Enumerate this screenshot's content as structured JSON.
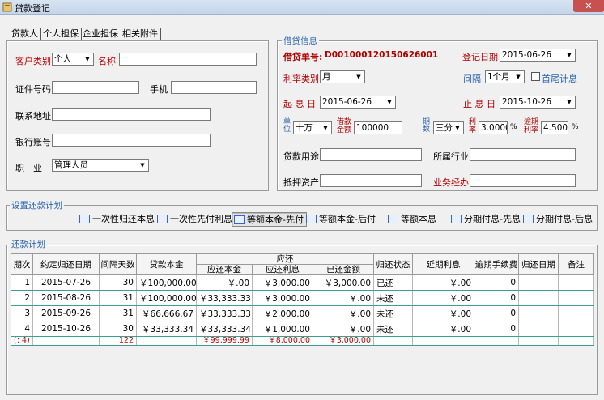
{
  "window": {
    "title": "贷款登记",
    "close_glyph": "✕"
  },
  "tabs": [
    "贷款人",
    "个人担保",
    "企业担保",
    "相关附件"
  ],
  "borrower": {
    "customer_type_label": "客户类别",
    "customer_type_value": "个人",
    "name_label": "名称",
    "name_value": "",
    "id_label": "证件号码",
    "id_value": "",
    "phone_label": "手机",
    "phone_value": "",
    "address_label": "联系地址",
    "address_value": "",
    "bank_label": "银行账号",
    "bank_value": "",
    "job_label": "职　业",
    "job_value": "管理人员"
  },
  "loan": {
    "section_title": "借贷信息",
    "number_label": "借贷单号:",
    "number_value": "D001000120150626001",
    "reg_date_label": "登记日期",
    "reg_date_value": "2015-06-26",
    "rate_type_label": "利率类别",
    "rate_type_value": "月",
    "interval_label": "间隔",
    "interval_value": "1个月",
    "tail_label": "首尾计息",
    "tail_checked": false,
    "start_label": "起 息 日",
    "start_value": "2015-06-26",
    "stop_label": "止 息 日",
    "stop_value": "2015-10-26",
    "unit_label": "单位",
    "unit_value": "十万",
    "amount_label_line1": "借款",
    "amount_label_line2": "金额",
    "amount_value": "100000",
    "period_label": "期数",
    "period_value": "三分",
    "rate_label_line1": "利",
    "rate_label_line2": "率",
    "rate_value": "3.0000",
    "rate_pct": "%",
    "overdue_label_line1": "逾期",
    "overdue_label_line2": "利率",
    "overdue_value": "4.5000",
    "overdue_pct": "%",
    "purpose_label": "贷款用途",
    "purpose_value": "",
    "industry_label": "所属行业",
    "industry_value": "",
    "collateral_label": "抵押资产",
    "collateral_value": "",
    "manager_label": "业务经办",
    "manager_value": ""
  },
  "plan": {
    "section_title": "设置还款计划",
    "buttons": [
      "一次性归还本息",
      "一次性先付利息",
      "等额本金-先付",
      "等额本金-后付",
      "等额本息",
      "分期付息-先息",
      "分期付息-后息"
    ],
    "pressed_index": 2
  },
  "schedule": {
    "section_title": "还款计划",
    "group_header": "应还",
    "headers": [
      "期次",
      "约定归还日期",
      "间隔天数",
      "贷款本金",
      "应还本金",
      "应还利息",
      "已还金额",
      "归还状态",
      "延期利息",
      "逾期手续费",
      "归还日期",
      "备注"
    ],
    "rows": [
      [
        "1",
        "2015-07-26",
        "30",
        "￥100,000.00",
        "￥.00",
        "￥3,000.00",
        "￥3,000.00",
        "已还",
        "￥.00",
        "0",
        "",
        ""
      ],
      [
        "2",
        "2015-08-26",
        "31",
        "￥100,000.00",
        "￥33,333.33",
        "￥3,000.00",
        "￥.00",
        "未还",
        "￥.00",
        "0",
        "",
        ""
      ],
      [
        "3",
        "2015-09-26",
        "31",
        "￥66,666.67",
        "￥33,333.33",
        "￥2,000.00",
        "￥.00",
        "未还",
        "￥.00",
        "0",
        "",
        ""
      ],
      [
        "4",
        "2015-10-26",
        "30",
        "￥33,333.34",
        "￥33,333.34",
        "￥1,000.00",
        "￥.00",
        "未还",
        "￥.00",
        "0",
        "",
        ""
      ]
    ],
    "total": [
      "(: 4)",
      "",
      "122",
      "",
      "￥99,999.99",
      "￥8,000.00",
      "￥3,000.00",
      "",
      "",
      "",
      "",
      ""
    ]
  }
}
